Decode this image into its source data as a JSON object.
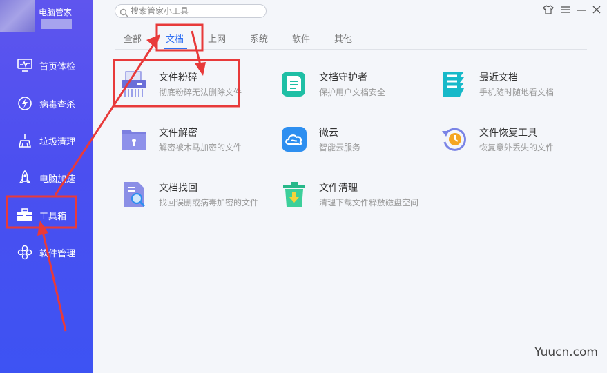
{
  "app": {
    "name": "电脑管家"
  },
  "sidebar": {
    "items": [
      {
        "label": "首页体检",
        "icon": "monitor-icon"
      },
      {
        "label": "病毒查杀",
        "icon": "shield-lightning-icon"
      },
      {
        "label": "垃圾清理",
        "icon": "broom-icon"
      },
      {
        "label": "电脑加速",
        "icon": "rocket-icon"
      },
      {
        "label": "工具箱",
        "icon": "toolbox-icon",
        "active": true
      },
      {
        "label": "软件管理",
        "icon": "apps-icon"
      }
    ]
  },
  "search": {
    "placeholder": "搜索管家小工具"
  },
  "tabs": [
    {
      "label": "全部"
    },
    {
      "label": "文档",
      "active": true
    },
    {
      "label": "上网"
    },
    {
      "label": "系统"
    },
    {
      "label": "软件"
    },
    {
      "label": "其他"
    }
  ],
  "tools": [
    {
      "name": "文件粉碎",
      "desc": "彻底粉碎无法删除文件",
      "icon": "shredder-icon",
      "color": "#6a6fd8"
    },
    {
      "name": "文档守护者",
      "desc": "保护用户文档安全",
      "icon": "document-guard-icon",
      "color": "#1fbfa5"
    },
    {
      "name": "最近文档",
      "desc": "手机随时随地看文档",
      "icon": "recent-docs-icon",
      "color": "#17b9c9"
    },
    {
      "name": "文件解密",
      "desc": "解密被木马加密的文件",
      "icon": "folder-lock-icon",
      "color": "#7c7fe0"
    },
    {
      "name": "微云",
      "desc": "智能云服务",
      "icon": "cloud-icon",
      "color": "#2e8ff0"
    },
    {
      "name": "文件恢复工具",
      "desc": "恢复意外丢失的文件",
      "icon": "restore-clock-icon",
      "color": "#7a84e6"
    },
    {
      "name": "文档找回",
      "desc": "找回误删或病毒加密的文件",
      "icon": "doc-search-icon",
      "color": "#8b8fe6"
    },
    {
      "name": "文件清理",
      "desc": "清理下载文件释放磁盘空间",
      "icon": "trash-download-icon",
      "color": "#28b88a"
    }
  ],
  "window_controls": [
    "skin-icon",
    "menu-icon",
    "minimize-icon",
    "close-icon"
  ],
  "watermark": "Yuucn.com",
  "colors": {
    "sidebar": "#4b4ff0",
    "accent": "#2f6ff2",
    "annotation": "#e83a3a"
  }
}
